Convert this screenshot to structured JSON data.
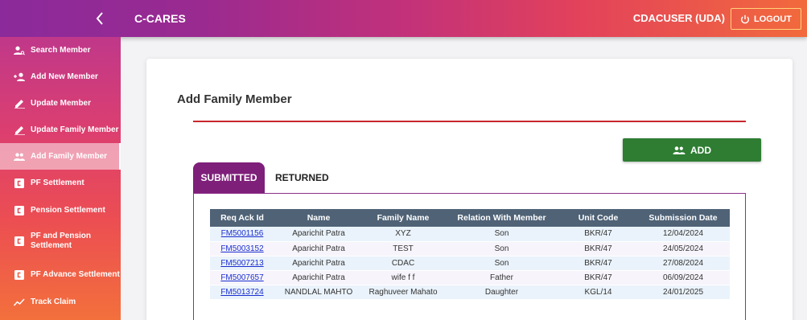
{
  "header": {
    "app_title": "C-CARES",
    "user": "CDACUSER (UDA)",
    "logout_label": "LOGOUT"
  },
  "sidebar": {
    "items": [
      {
        "label": "Search Member",
        "icon": "person-search-icon"
      },
      {
        "label": "Add New Member",
        "icon": "person-add-icon"
      },
      {
        "label": "Update Member",
        "icon": "edit-icon"
      },
      {
        "label": "Update Family Member",
        "icon": "edit-icon"
      },
      {
        "label": "Add Family Member",
        "icon": "group-icon",
        "active": true
      },
      {
        "label": "PF Settlement",
        "icon": "document-icon"
      },
      {
        "label": "Pension Settlement",
        "icon": "document-icon"
      },
      {
        "label_line1": "PF and Pension",
        "label_line2": "Settlement",
        "icon": "document-icon"
      },
      {
        "label": "PF Advance Settlement",
        "icon": "document-icon"
      },
      {
        "label": "Track Claim",
        "icon": "trend-icon"
      }
    ]
  },
  "main": {
    "title": "Add Family Member",
    "add_button": "ADD",
    "tabs": [
      {
        "label": "SUBMITTED",
        "active": true
      },
      {
        "label": "RETURNED",
        "active": false
      }
    ],
    "table": {
      "columns": [
        "Req Ack Id",
        "Name",
        "Family Name",
        "Relation With Member",
        "Unit Code",
        "Submission Date"
      ],
      "rows": [
        [
          "FM5001156",
          "Aparichit Patra",
          "XYZ",
          "Son",
          "BKR/47",
          "12/04/2024"
        ],
        [
          "FM5003152",
          "Aparichit Patra",
          "TEST",
          "Son",
          "BKR/47",
          "24/05/2024"
        ],
        [
          "FM5007213",
          "Aparichit Patra",
          "CDAC",
          "Son",
          "BKR/47",
          "27/08/2024"
        ],
        [
          "FM5007657",
          "Aparichit Patra",
          "wife f f",
          "Father",
          "BKR/47",
          "06/09/2024"
        ],
        [
          "FM5013724",
          "NANDLAL MAHTO",
          "Raghuveer Mahato",
          "Daughter",
          "KGL/14",
          "24/01/2025"
        ]
      ]
    }
  },
  "colors": {
    "accent_purple": "#7e1f7a",
    "add_green": "#2e7d32",
    "rule_red": "#c8262b",
    "table_header": "#4f6276",
    "link_blue": "#1a2fd0"
  }
}
